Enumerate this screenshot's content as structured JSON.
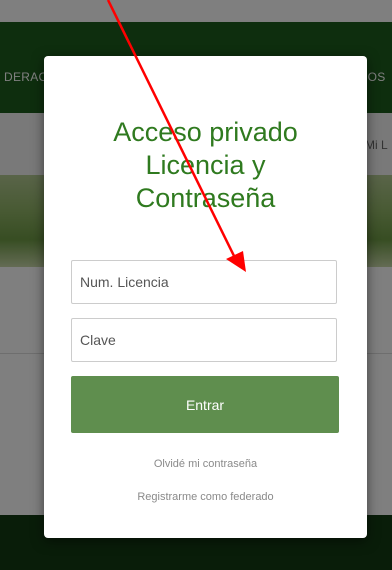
{
  "background": {
    "nav_left_text": "DERAC",
    "nav_right_text": "IOS",
    "sub_right_text": "Mi L"
  },
  "modal": {
    "title_line1": "Acceso privado",
    "title_line2": "Licencia y",
    "title_line3": "Contraseña",
    "licencia_placeholder": "Num. Licencia",
    "clave_placeholder": "Clave",
    "submit_label": "Entrar",
    "forgot_link": "Olvidé mi contraseña",
    "register_link": "Registrarme como federado"
  },
  "colors": {
    "accent_green": "#2f7a1f",
    "button_green": "#5f8e4e",
    "annotation_arrow": "#ff0000"
  },
  "annotation": {
    "type": "arrow",
    "points_to": "licencia-field"
  }
}
